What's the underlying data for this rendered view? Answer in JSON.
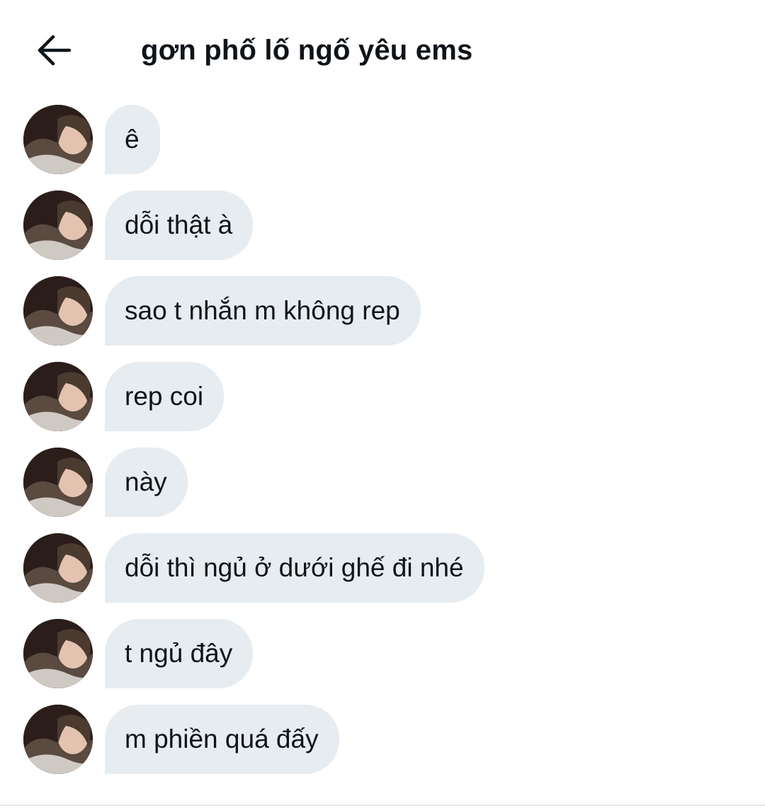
{
  "header": {
    "title": "gơn phố lố ngố yêu ems",
    "back_icon": "arrow-left-icon"
  },
  "messages": [
    {
      "text": "ê"
    },
    {
      "text": "dỗi thật à"
    },
    {
      "text": "sao t nhắn m không rep"
    },
    {
      "text": "rep coi"
    },
    {
      "text": "này"
    },
    {
      "text": "dỗi thì ngủ ở dưới ghế đi nhé"
    },
    {
      "text": "t ngủ đây"
    },
    {
      "text": "m phiền quá đấy"
    }
  ],
  "colors": {
    "bubble": "#e7ecf0",
    "text": "#0f1419",
    "background": "#ffffff"
  }
}
